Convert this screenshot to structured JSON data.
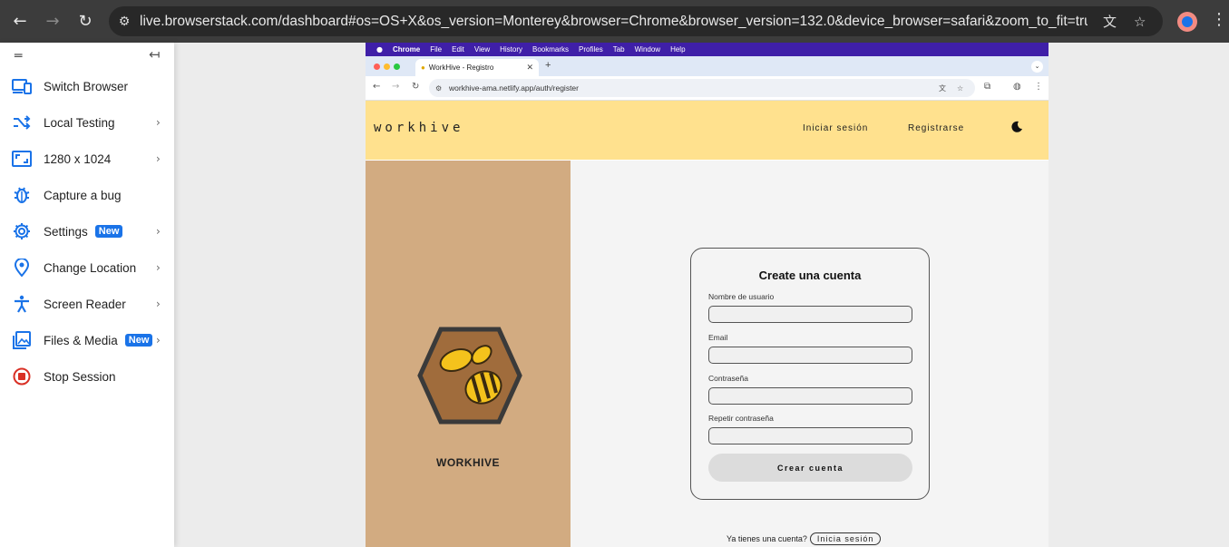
{
  "browser": {
    "url": "live.browserstack.com/dashboard#os=OS+X&os_version=Monterey&browser=Chrome&browser_version=132.0&device_browser=safari&zoom_to_fit=true&full_scre..."
  },
  "sidebar": {
    "items": [
      {
        "label": "Switch Browser",
        "icon": "switch-browser-icon",
        "chevron": false,
        "badge": ""
      },
      {
        "label": "Local Testing",
        "icon": "local-testing-icon",
        "chevron": true,
        "badge": ""
      },
      {
        "label": "1280 x 1024",
        "icon": "resolution-icon",
        "chevron": true,
        "badge": ""
      },
      {
        "label": "Capture a bug",
        "icon": "bug-icon",
        "chevron": false,
        "badge": ""
      },
      {
        "label": "Settings",
        "icon": "gear-icon",
        "chevron": true,
        "badge": "New"
      },
      {
        "label": "Change Location",
        "icon": "location-pin-icon",
        "chevron": true,
        "badge": ""
      },
      {
        "label": "Screen Reader",
        "icon": "accessibility-icon",
        "chevron": true,
        "badge": ""
      },
      {
        "label": "Files & Media",
        "icon": "image-icon",
        "chevron": true,
        "badge": "New"
      },
      {
        "label": "Stop Session",
        "icon": "stop-icon",
        "chevron": false,
        "badge": ""
      }
    ]
  },
  "remote": {
    "mac_menu": [
      "Chrome",
      "File",
      "Edit",
      "View",
      "History",
      "Bookmarks",
      "Profiles",
      "Tab",
      "Window",
      "Help"
    ],
    "tab_title": "WorkHive - Registro",
    "inner_url": "workhive-ama.netlify.app/auth/register",
    "site": {
      "logo": "workhive",
      "nav_login": "Iniciar sesión",
      "nav_register": "Registrarse",
      "brand": "WORKHIVE",
      "form": {
        "title": "Create una cuenta",
        "username_label": "Nombre de usuario",
        "email_label": "Email",
        "password_label": "Contraseña",
        "repeat_label": "Repetir contraseña",
        "submit": "Crear cuenta"
      },
      "footer_question": "Ya tienes una cuenta?",
      "footer_login": "Inicia sesión"
    }
  },
  "colors": {
    "header_yellow": "#ffe18e",
    "panel_tan": "#d2ab81",
    "accent_blue": "#1a73e8",
    "hex_brown": "#a06c3c",
    "bee_yellow": "#f4c21c"
  }
}
